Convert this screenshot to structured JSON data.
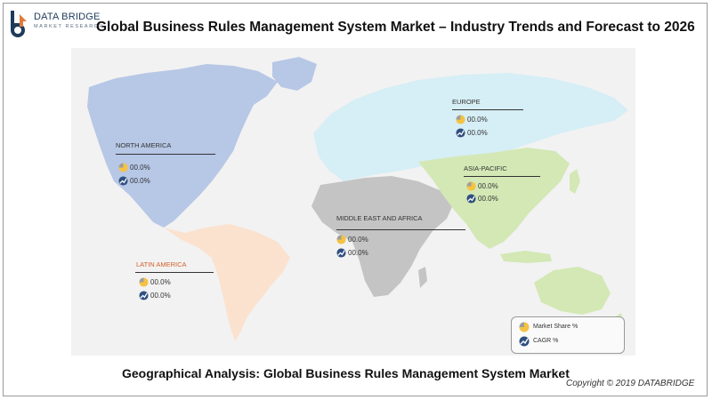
{
  "brand": {
    "name": "DATA BRIDGE",
    "tagline": "MARKET RESEARCH",
    "color": "#1f3b5b",
    "accent": "#e07b39"
  },
  "title": "Global Business Rules Management System Market – Industry Trends and Forecast to 2026",
  "map": {
    "background": "#f2f2f2",
    "regions": {
      "north_america": {
        "label": "NORTH AMERICA",
        "market_share": "00.0%",
        "cagr": "00.0%",
        "color": "#b7c7e6"
      },
      "latin_america": {
        "label": "LATIN AMERICA",
        "market_share": "00.0%",
        "cagr": "00.0%",
        "color": "#fbe2cf"
      },
      "europe": {
        "label": "EUROPE",
        "market_share": "00.0%",
        "cagr": "00.0%",
        "color": "#d6eef5"
      },
      "middle_east_africa": {
        "label": "MIDDLE EAST AND AFRICA",
        "market_share": "00.0%",
        "cagr": "00.0%",
        "color": "#c4c4c4"
      },
      "asia_pacific": {
        "label": "ASIA-PACIFIC",
        "market_share": "00.0%",
        "cagr": "00.0%",
        "color": "#d3e8b5"
      }
    }
  },
  "legend": {
    "market_share": "Market Share  %",
    "cagr": "CAGR %"
  },
  "footer": {
    "title": "Geographical Analysis: Global Business Rules Management System Market",
    "copyright": "Copyright © 2019 DATABRIDGE"
  }
}
